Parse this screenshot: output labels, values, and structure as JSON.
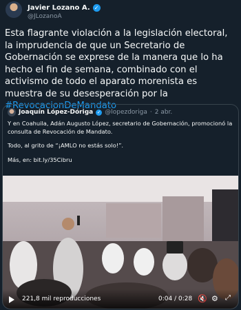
{
  "author": {
    "name": "Javier Lozano A.",
    "handle": "@JLozanoA",
    "verified_icon": "verified-badge-icon"
  },
  "tweet": {
    "text": "Esta flagrante violación a la legislación electoral, la imprudencia de que un Secretario de Gobernación se exprese de la manera que lo ha hecho el fin de semana, combinado con el activismo de todo el aparato morenista es muestra de su desesperación por la ",
    "hashtag": "#RevocacionDeMandato"
  },
  "quote": {
    "name": "Joaquín López-Dóriga",
    "handle": "@lopezdoriga",
    "dot": "·",
    "date": "2 abr.",
    "paragraphs": [
      "Y en Coahuila, Adán Augusto López, secretario de Gobernación, promocionó la consulta de Revocación de Mandato.",
      "Todo, al grito de “¡AMLO no estás solo!”.",
      "Más, en: bit.ly/35Cibru"
    ]
  },
  "video": {
    "views": "221,8 mil reproducciones",
    "time": "0:04 / 0:28",
    "icons": [
      "play-icon",
      "mute-icon",
      "settings-icon",
      "fullscreen-icon"
    ]
  },
  "colors": {
    "background": "#15202b",
    "link": "#1d9bf0",
    "secondary_text": "#8b98a5",
    "border": "#38444d"
  }
}
